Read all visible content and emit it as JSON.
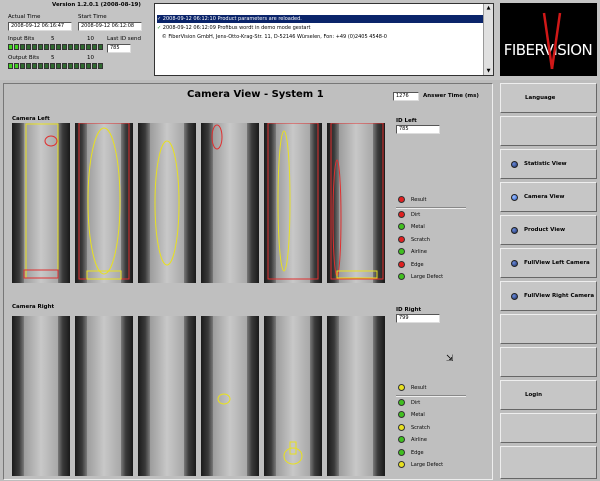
{
  "header": {
    "version": "Version 1.2.0.1 (2008-08-19)",
    "actual_time_label": "Actual Time",
    "actual_time": "2008-09-12 06:16:47",
    "start_time_label": "Start Time",
    "start_time": "2008-09-12 06:12:08",
    "input_bits_label": "Input Bits",
    "output_bits_label": "Output Bits",
    "bit_marker_5": "5",
    "bit_marker_10": "10",
    "last_id_send_label": "Last ID send",
    "last_id_send": "785"
  },
  "log": {
    "lines": [
      "2008-09-12 06:12:10 Product parameters are reloaded.",
      "2008-09-12 06:12:09 Profibus wordt in demo mode gestart",
      "© FiberVision GmbH, Jens-Otto-Krag-Str. 11, D-52146 Würselen, Fon: +49 (0)2405 4548-0"
    ]
  },
  "brand": {
    "logo_text": "FIBERVISION"
  },
  "main": {
    "title": "Camera View - System 1",
    "answer_time_value": "1276",
    "answer_time_label": "Answer Time (ms)",
    "camera_left_label": "Camera Left",
    "camera_right_label": "Camera Right",
    "id_left_label": "ID Left",
    "id_left_value": "785",
    "id_right_label": "ID Right",
    "id_right_value": "799"
  },
  "status_left": [
    {
      "label": "Result",
      "color": "#e02020"
    },
    {
      "label": "Dirt",
      "color": "#e02020"
    },
    {
      "label": "Metal",
      "color": "#40c020"
    },
    {
      "label": "Scratch",
      "color": "#e02020"
    },
    {
      "label": "Airline",
      "color": "#40c020"
    },
    {
      "label": "Edge",
      "color": "#e02020"
    },
    {
      "label": "Large Defect",
      "color": "#40c020"
    }
  ],
  "status_right": [
    {
      "label": "Result",
      "color": "#e8e020"
    },
    {
      "label": "Dirt",
      "color": "#40c020"
    },
    {
      "label": "Metal",
      "color": "#40c020"
    },
    {
      "label": "Scratch",
      "color": "#e8e020"
    },
    {
      "label": "Airline",
      "color": "#40c020"
    },
    {
      "label": "Edge",
      "color": "#40c020"
    },
    {
      "label": "Large Defect",
      "color": "#e8e020"
    }
  ],
  "nav": {
    "language": "Language",
    "statistic": "Statistic View",
    "camera": "Camera View",
    "product": "Product View",
    "fullview_left": "FullView Left Camera",
    "fullview_right": "FullView Right Camera",
    "login": "Login"
  },
  "colors": {
    "ok": "#40c020",
    "error": "#e02020",
    "warn": "#e8e020",
    "accent": "#1b2f6a"
  }
}
